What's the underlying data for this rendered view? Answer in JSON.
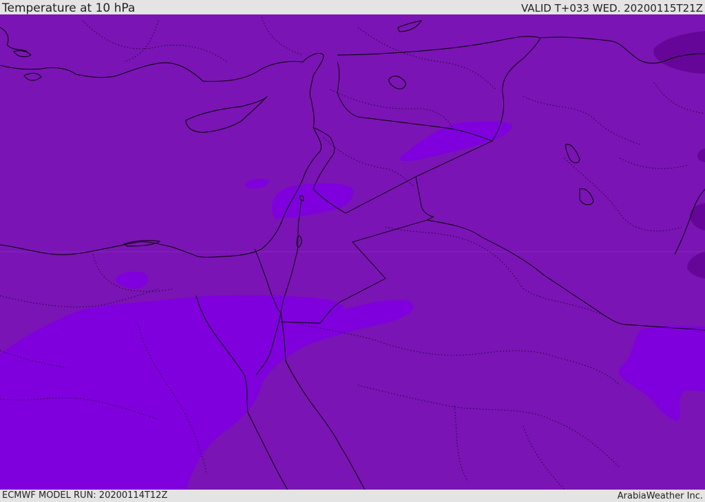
{
  "header": {
    "title": "Temperature at 10 hPa",
    "valid": "VALID T+033 WED. 20200115T21Z"
  },
  "footer": {
    "model_run": "ECMWF MODEL RUN: 20200114T12Z",
    "credit": "ArabiaWeather Inc."
  },
  "colors": {
    "base_field": "#7a14b4",
    "warm_field": "#7f00dd",
    "cold_field": "#660699",
    "coastline": "#000000"
  }
}
